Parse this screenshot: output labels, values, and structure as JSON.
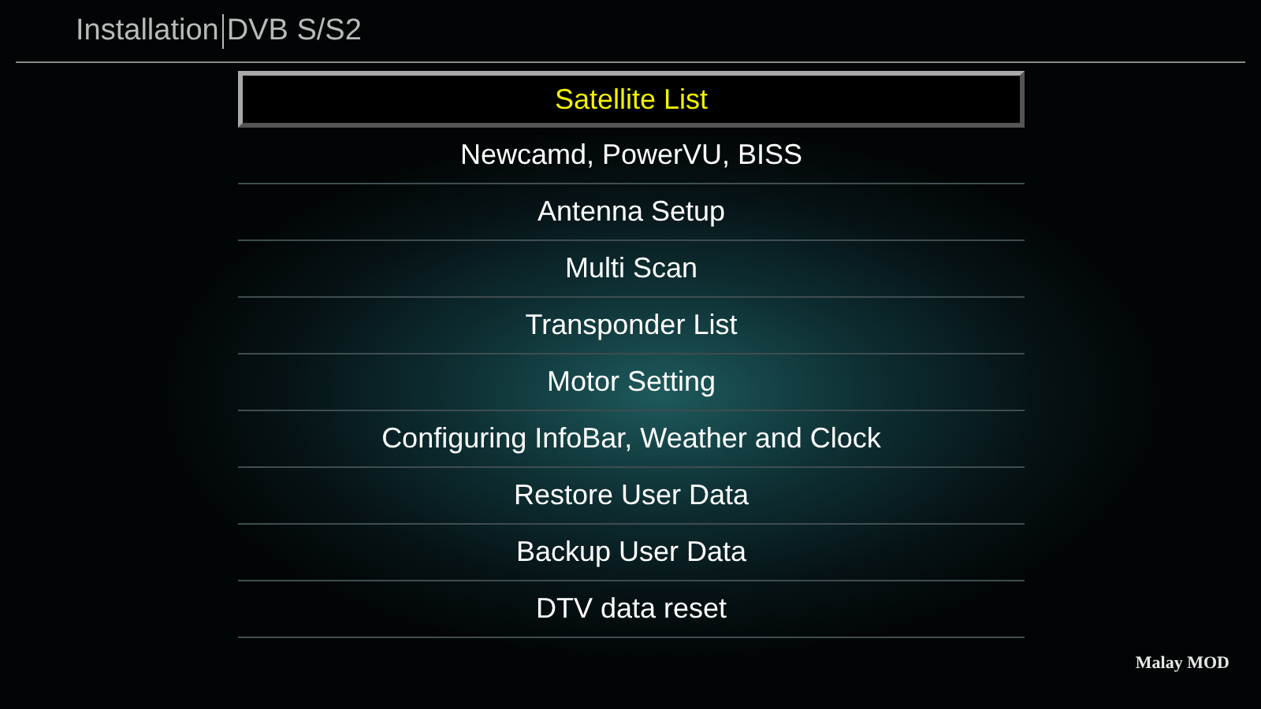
{
  "header": {
    "title": "Installation",
    "subtitle": "DVB S/S2"
  },
  "menu": [
    {
      "label": "Satellite List",
      "selected": true
    },
    {
      "label": "Newcamd, PowerVU, BISS",
      "selected": false
    },
    {
      "label": "Antenna Setup",
      "selected": false
    },
    {
      "label": "Multi Scan",
      "selected": false
    },
    {
      "label": "Transponder List",
      "selected": false
    },
    {
      "label": "Motor Setting",
      "selected": false
    },
    {
      "label": "Configuring InfoBar, Weather and Clock",
      "selected": false
    },
    {
      "label": "Restore User Data",
      "selected": false
    },
    {
      "label": "Backup User Data",
      "selected": false
    },
    {
      "label": "DTV data reset",
      "selected": false
    }
  ],
  "footer": {
    "mod_label": "Malay MOD"
  }
}
